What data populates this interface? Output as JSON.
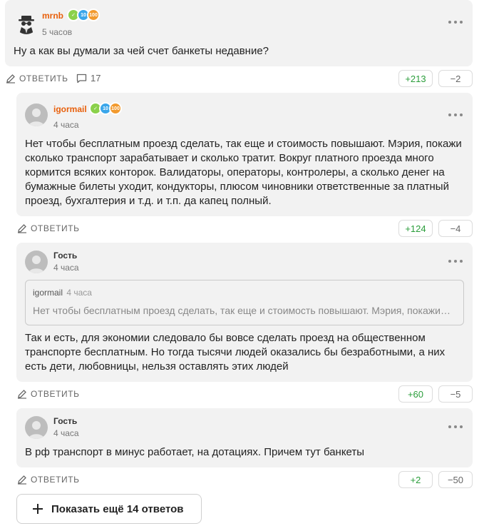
{
  "comments": [
    {
      "author": "mrnb",
      "time": "5 часов",
      "text": "Ну а как вы думали за чей счет банкеты недавние?",
      "badges": [
        "✓",
        "10",
        "100"
      ],
      "reply_label": "ОТВЕТИТЬ",
      "replies_count": "17",
      "upvotes": "+213",
      "downvotes": "−2"
    },
    {
      "author": "igormail",
      "time": "4 часа",
      "text": "Нет чтобы бесплатным проезд сделать, так еще и стоимость повышают. Мэрия, покажи сколько транспорт зарабатывает и сколько тратит. Вокруг платного проезда много кормится всяких конторок. Валидаторы, операторы, контролеры, а сколько денег на бумажные билеты уходит, кондукторы, плюсом чиновники ответственные за платный проезд, бухгалтерия и т.д. и т.п. да капец полный.",
      "badges": [
        "✓",
        "10",
        "100"
      ],
      "reply_label": "ОТВЕТИТЬ",
      "upvotes": "+124",
      "downvotes": "−4"
    },
    {
      "author": "Гость",
      "time": "4 часа",
      "quote_author": "igormail",
      "quote_time": "4 часа",
      "quote_text": "Нет чтобы бесплатным проезд сделать, так еще и стоимость повышают. Мэрия, покажи сколько транспорт зарабатывает и сколько тратит.",
      "text": "Так и есть, для экономии следовало бы вовсе сделать проезд на общественном транспорте бесплатным. Но тогда тысячи людей оказались бы безработными, а них есть дети, любовницы, нельзя оставлять этих людей",
      "reply_label": "ОТВЕТИТЬ",
      "upvotes": "+60",
      "downvotes": "−5"
    },
    {
      "author": "Гость",
      "time": "4 часа",
      "text": "В рф транспорт в минус работает, на дотациях. Причем тут банкеты",
      "reply_label": "ОТВЕТИТЬ",
      "upvotes": "+2",
      "downvotes": "−50"
    }
  ],
  "show_more_label": "Показать ещё 14 ответов",
  "icons": {
    "reply": "pencil-icon",
    "replies": "comment-bubble-icon",
    "more": "more-dots-icon",
    "show_more": "plus-icon"
  },
  "colors": {
    "card_bg": "#f2f2f2",
    "author_accent": "#e8600c",
    "upvote": "#2a9d3a"
  }
}
